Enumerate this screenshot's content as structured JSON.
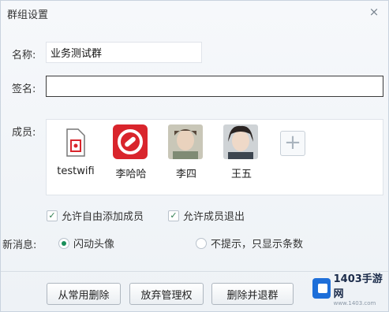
{
  "window": {
    "title": "群组设置",
    "close_glyph": "×"
  },
  "form": {
    "name_label": "名称:",
    "name_value": "业务测试群",
    "sign_label": "签名:",
    "sign_value": "",
    "members_label": "成员:",
    "new_msg_label": "新消息:"
  },
  "members": [
    {
      "name": "testwifi",
      "icon": "file-icon"
    },
    {
      "name": "李哈哈",
      "icon": "link-logo-icon",
      "color": "#d9252c"
    },
    {
      "name": "李四",
      "icon": "avatar-photo"
    },
    {
      "name": "王五",
      "icon": "avatar-photo"
    }
  ],
  "add_member_glyph": "+",
  "options": {
    "allow_add": "允许自由添加成员",
    "allow_exit": "允许成员退出",
    "flash_avatar": "闪动头像",
    "no_prompt": "不提示，只显示条数"
  },
  "buttons": {
    "remove_common": "从常用删除",
    "give_up_admin": "放弃管理权",
    "delete_group": "删除并退群"
  },
  "watermark": {
    "brand": "1403手游网",
    "sub": "www.1403.com"
  },
  "colors": {
    "accent_green": "#1a8f5a",
    "brand_red": "#d9252c",
    "watermark_blue": "#1e6fd9"
  }
}
